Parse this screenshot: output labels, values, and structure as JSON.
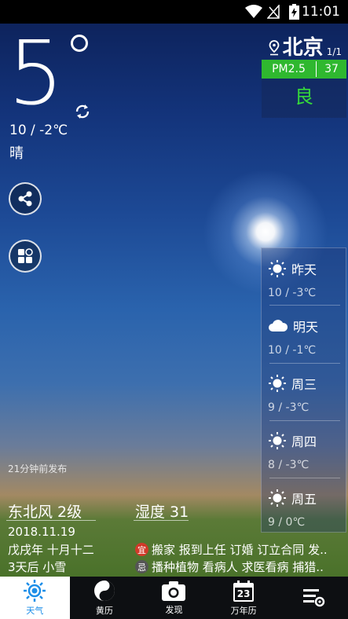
{
  "status_bar": {
    "time": "11:01"
  },
  "current": {
    "temperature": "5",
    "range": "10 / -2℃",
    "condition": "晴"
  },
  "location": {
    "city": "北京",
    "page_indicator": "1/1"
  },
  "air_quality": {
    "label": "PM2.5",
    "value": "37",
    "level": "良",
    "colors": {
      "bar": "#2fb82f",
      "level": "#35d83a"
    }
  },
  "forecast": [
    {
      "day": "昨天",
      "temp": "10 / -3℃",
      "icon": "sun-icon"
    },
    {
      "day": "明天",
      "temp": "10 / -1℃",
      "icon": "cloud-icon"
    },
    {
      "day": "周三",
      "temp": "9 / -3℃",
      "icon": "sun-icon"
    },
    {
      "day": "周四",
      "temp": "8 / -3℃",
      "icon": "sun-icon"
    },
    {
      "day": "周五",
      "temp": "9 / 0℃",
      "icon": "sun-icon"
    }
  ],
  "published": "21分钟前发布",
  "details": {
    "wind": "东北风 2级",
    "humidity": "湿度 31",
    "date": "2018.11.19",
    "lunar": "戊戌年 十月十二",
    "later": "3天后 小雪",
    "suitable_badge": "宜",
    "suitable": "搬家 报到上任 订婚 订立合同 发..",
    "avoid_badge": "忌",
    "avoid": "播种植物 看病人 求医看病 捕猎.."
  },
  "tabs": [
    {
      "label": "天气",
      "icon": "sun-icon",
      "active": true
    },
    {
      "label": "黄历",
      "icon": "yin-yang-icon",
      "active": false
    },
    {
      "label": "发现",
      "icon": "camera-icon",
      "active": false
    },
    {
      "label": "万年历",
      "icon": "calendar-icon",
      "active": false,
      "calendar_day": "23"
    },
    {
      "label": "",
      "icon": "settings-menu-icon",
      "active": false
    }
  ],
  "accent_color": "#1d8ee8"
}
